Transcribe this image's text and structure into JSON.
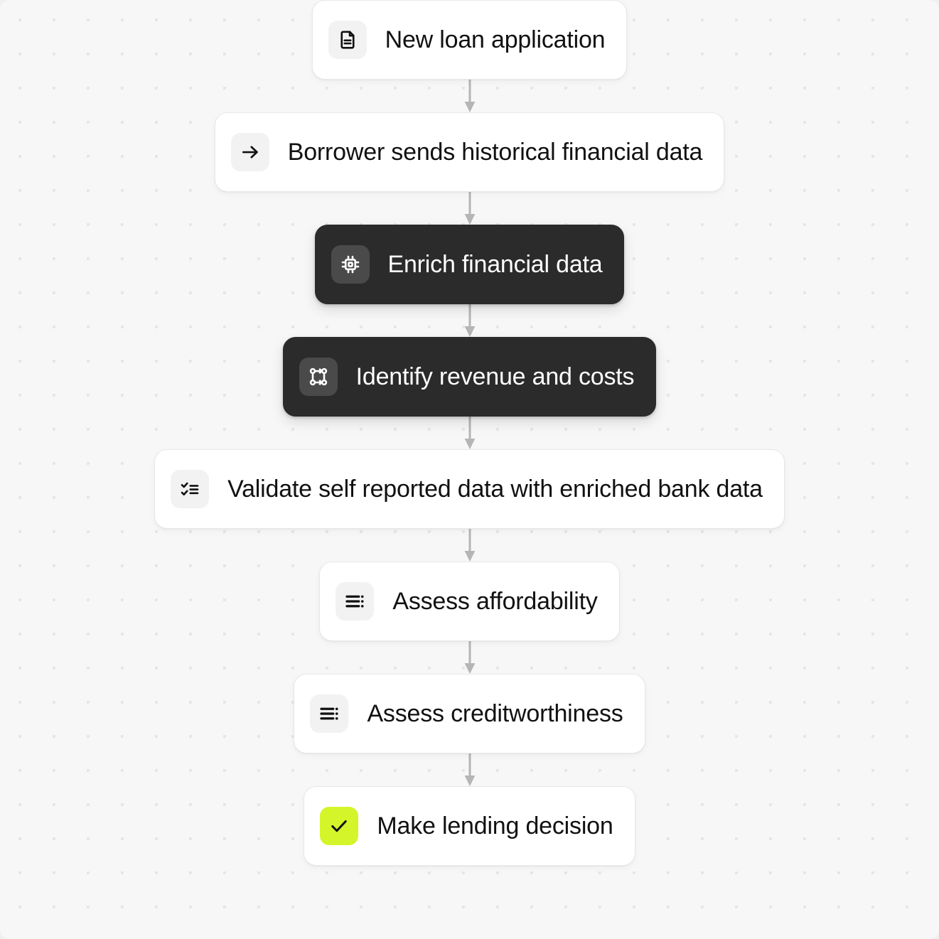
{
  "canvas": {
    "background_color": "#f7f7f7",
    "dot_color": "#e6e6e6"
  },
  "colors": {
    "node_light_bg": "#ffffff",
    "node_light_border": "#e8e8e8",
    "node_dark_bg": "#2b2b2b",
    "tile_light_bg": "#f2f2f2",
    "tile_dark_bg": "#4a4a4a",
    "accent_lime": "#d4f529",
    "text_dark": "#111111",
    "text_light": "#ffffff",
    "connector": "#b5b5b5"
  },
  "flow": {
    "nodes": [
      {
        "id": "new-loan-application",
        "label": "New loan application",
        "icon": "document-icon",
        "theme": "light",
        "tile": "neutral",
        "gap_above": 0,
        "connector_height": 46
      },
      {
        "id": "borrower-sends-data",
        "label": "Borrower sends historical financial data",
        "icon": "arrow-right-icon",
        "theme": "light",
        "tile": "neutral",
        "connector_height": 46
      },
      {
        "id": "enrich-financial-data",
        "label": "Enrich financial data",
        "icon": "cpu-chip-icon",
        "theme": "dark",
        "tile": "neutral",
        "connector_height": 46
      },
      {
        "id": "identify-revenue-and-costs",
        "label": "Identify revenue and costs",
        "icon": "workflow-nodes-icon",
        "theme": "dark",
        "tile": "neutral",
        "connector_height": 46
      },
      {
        "id": "validate-self-reported-data",
        "label": "Validate self reported data with enriched bank data",
        "icon": "checklist-icon",
        "theme": "light",
        "tile": "neutral",
        "connector_height": 46
      },
      {
        "id": "assess-affordability",
        "label": "Assess affordability",
        "icon": "list-dots-icon",
        "theme": "light",
        "tile": "neutral",
        "connector_height": 46
      },
      {
        "id": "assess-creditworthiness",
        "label": "Assess creditworthiness",
        "icon": "list-dots-icon",
        "theme": "light",
        "tile": "neutral",
        "connector_height": 46
      },
      {
        "id": "make-lending-decision",
        "label": "Make lending decision",
        "icon": "check-icon",
        "theme": "light",
        "tile": "accent",
        "connector_height": 0
      }
    ]
  }
}
